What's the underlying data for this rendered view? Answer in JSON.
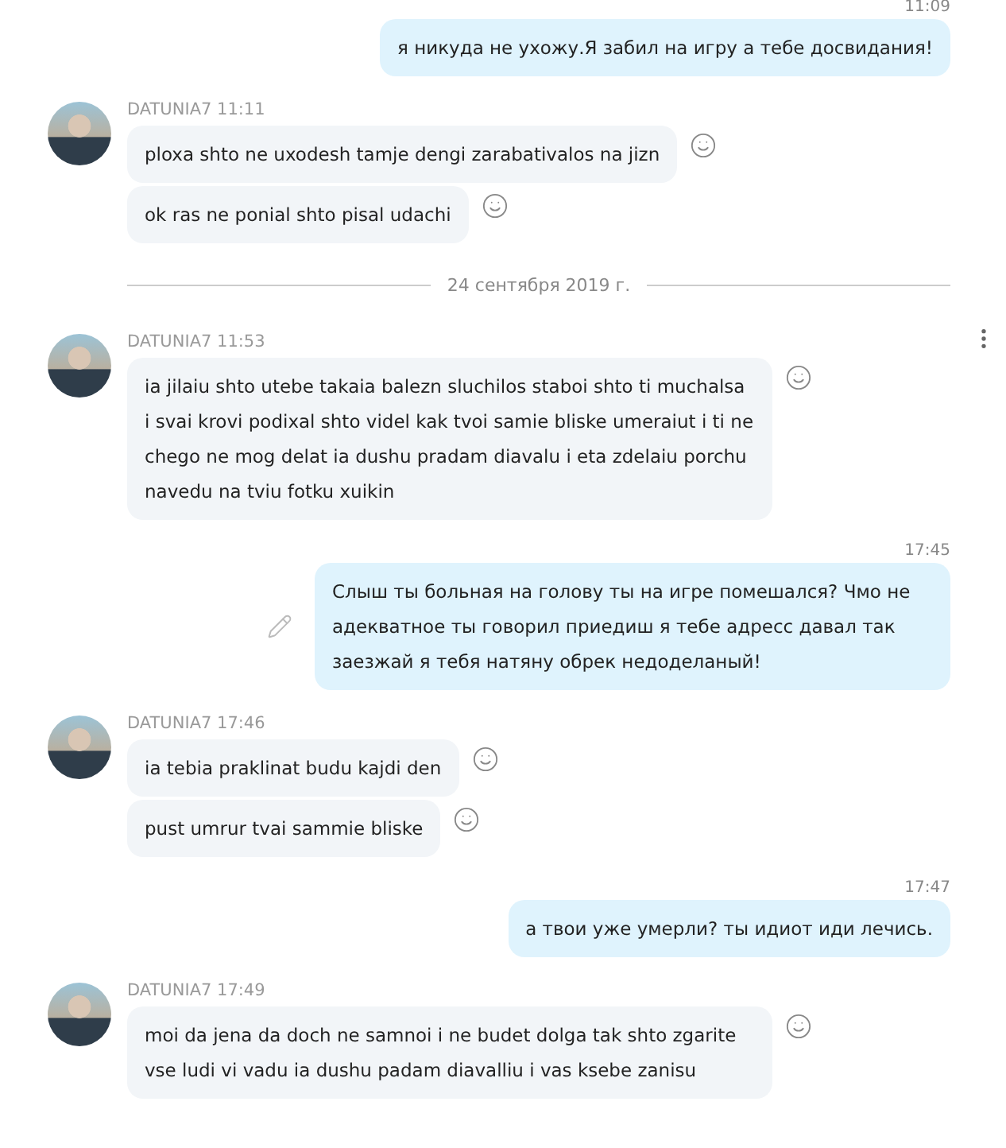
{
  "messages": [
    {
      "kind": "outgoing",
      "time": "11:09",
      "text": "я никуда не ухожу.Я забил на игру а тебе досвидания!",
      "show_edit": false
    },
    {
      "kind": "incoming",
      "sender": "DATUNIA7",
      "time": "11:11",
      "bubbles": [
        "ploxa shto ne uxodesh tamje dengi zarabativalos na jizn",
        "ok ras ne ponial shto pisal  udachi"
      ]
    },
    {
      "kind": "date",
      "label": "24 сентября 2019 г."
    },
    {
      "kind": "incoming",
      "sender": "DATUNIA7",
      "time": "11:53",
      "bubbles": [
        "ia jilaiu shto utebe takaia balezn sluchilos staboi shto ti muchalsa i svai krovi podixal shto videl kak tvoi samie bliske umeraiut i ti ne chego ne mog delat ia dushu pradam diavalu i eta zdelaiu  porchu navedu na tviu fotku xuikin"
      ]
    },
    {
      "kind": "outgoing",
      "time": "17:45",
      "text": "Слыш ты  больная на голову ты на игре помешался? Чмо не адекватное ты говорил приедиш я тебе адресс давал так заезжай  я тебя натяну обрек недоделаный!",
      "show_edit": true
    },
    {
      "kind": "incoming",
      "sender": "DATUNIA7",
      "time": "17:46",
      "bubbles": [
        "ia tebia praklinat budu kajdi den",
        "pust umrur tvai sammie bliske"
      ]
    },
    {
      "kind": "outgoing",
      "time": "17:47",
      "text": "а твои уже умерли? ты идиот иди лечись.",
      "show_edit": false
    },
    {
      "kind": "incoming",
      "sender": "DATUNIA7",
      "time": "17:49",
      "bubbles": [
        "moi da jena da doch ne samnoi i ne budet dolga tak shto zgarite vse ludi vi vadu ia dushu padam diavalliu i vas ksebe zanisu"
      ]
    }
  ]
}
